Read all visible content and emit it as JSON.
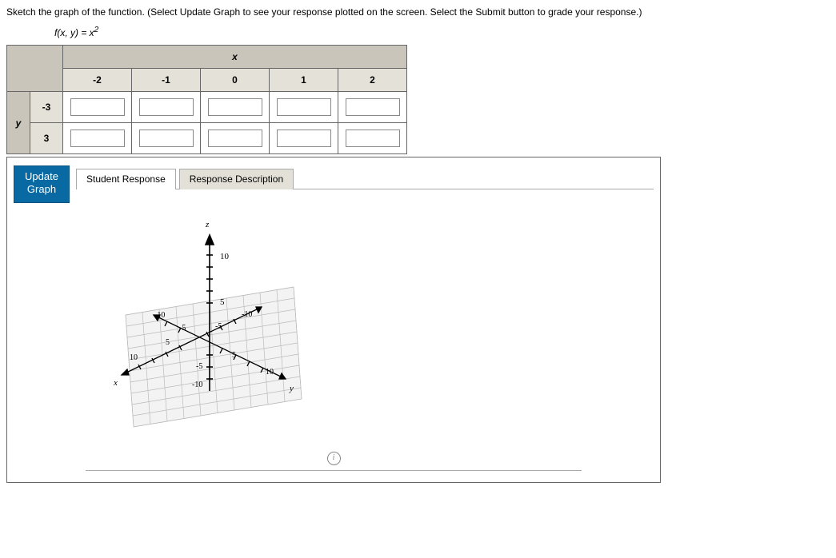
{
  "instructions": "Sketch the graph of the function. (Select Update Graph to see your response plotted on the screen. Select the Submit button to grade your response.)",
  "equation": {
    "lhs": "f(x, y) = x",
    "exponent": "2"
  },
  "table": {
    "x_label": "x",
    "y_label": "y",
    "x_cols": [
      "-2",
      "-1",
      "0",
      "1",
      "2"
    ],
    "y_rows": [
      "-3",
      "3"
    ],
    "cells": {
      "r0c0": "",
      "r0c1": "",
      "r0c2": "",
      "r0c3": "",
      "r0c4": "",
      "r1c0": "",
      "r1c1": "",
      "r1c2": "",
      "r1c3": "",
      "r1c4": ""
    }
  },
  "buttons": {
    "update": "Update\nGraph"
  },
  "tabs": {
    "student": "Student Response",
    "desc": "Response Description"
  },
  "axes": {
    "x": "x",
    "y": "y",
    "z": "z",
    "ticks": [
      "10",
      "5",
      "-5",
      "-10",
      "-10",
      "-5",
      "5",
      "10",
      "10",
      "5",
      "-5",
      "-10"
    ],
    "z_ticks": [
      "10",
      "5"
    ]
  },
  "chart_data": {
    "type": "3d-axes",
    "x_range": [
      -10,
      10
    ],
    "y_range": [
      -10,
      10
    ],
    "z_range": [
      -10,
      10
    ],
    "tick_step": 5,
    "series": []
  }
}
